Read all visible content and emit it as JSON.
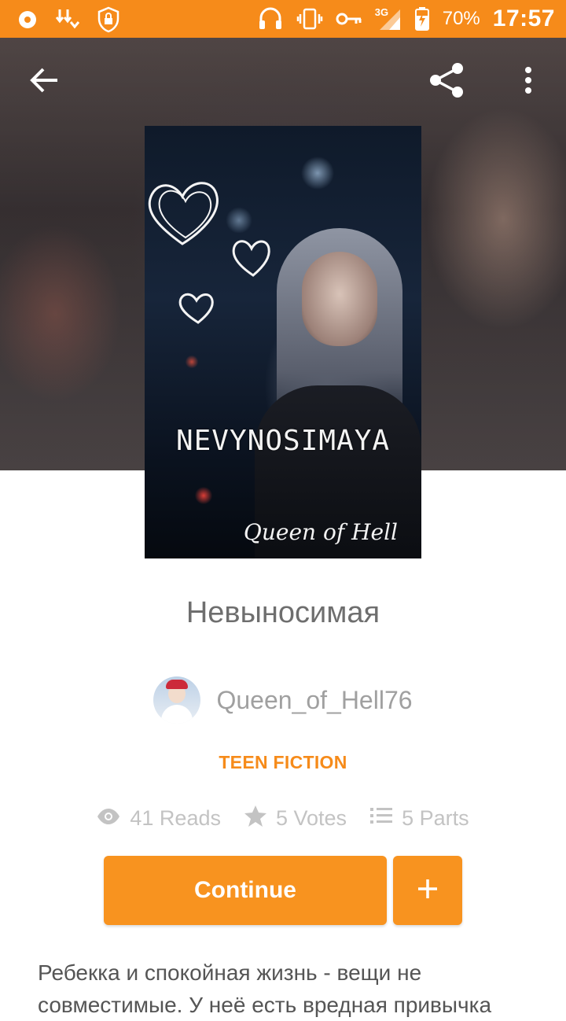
{
  "status_bar": {
    "battery_percent": "70%",
    "time": "17:57",
    "network": "3G",
    "icons": [
      "record-icon",
      "download-icon",
      "lock-shield-icon",
      "headset-icon",
      "vibrate-icon",
      "key-icon",
      "signal-icon",
      "battery-charging-icon"
    ]
  },
  "toolbar": {
    "back_icon": "back-arrow-icon",
    "share_icon": "share-icon",
    "menu_icon": "more-vertical-icon"
  },
  "cover": {
    "title_text": "NEVYNOSIMAYA",
    "author_text": "Queen of Hell"
  },
  "story": {
    "title": "Невыносимая",
    "author": "Queen_of_Hell76",
    "category": "TEEN FICTION",
    "reads": "41 Reads",
    "votes": "5 Votes",
    "parts": "5 Parts",
    "description": "Ребекка и спокойная жизнь - вещи не совместимые. У неё есть вредная привычка"
  },
  "actions": {
    "continue_label": "Continue",
    "add_icon": "plus-icon"
  },
  "colors": {
    "accent": "#f68b1a",
    "button": "#f8931f",
    "title_text": "#6e6e6e",
    "muted_text": "#c3c3c3"
  }
}
